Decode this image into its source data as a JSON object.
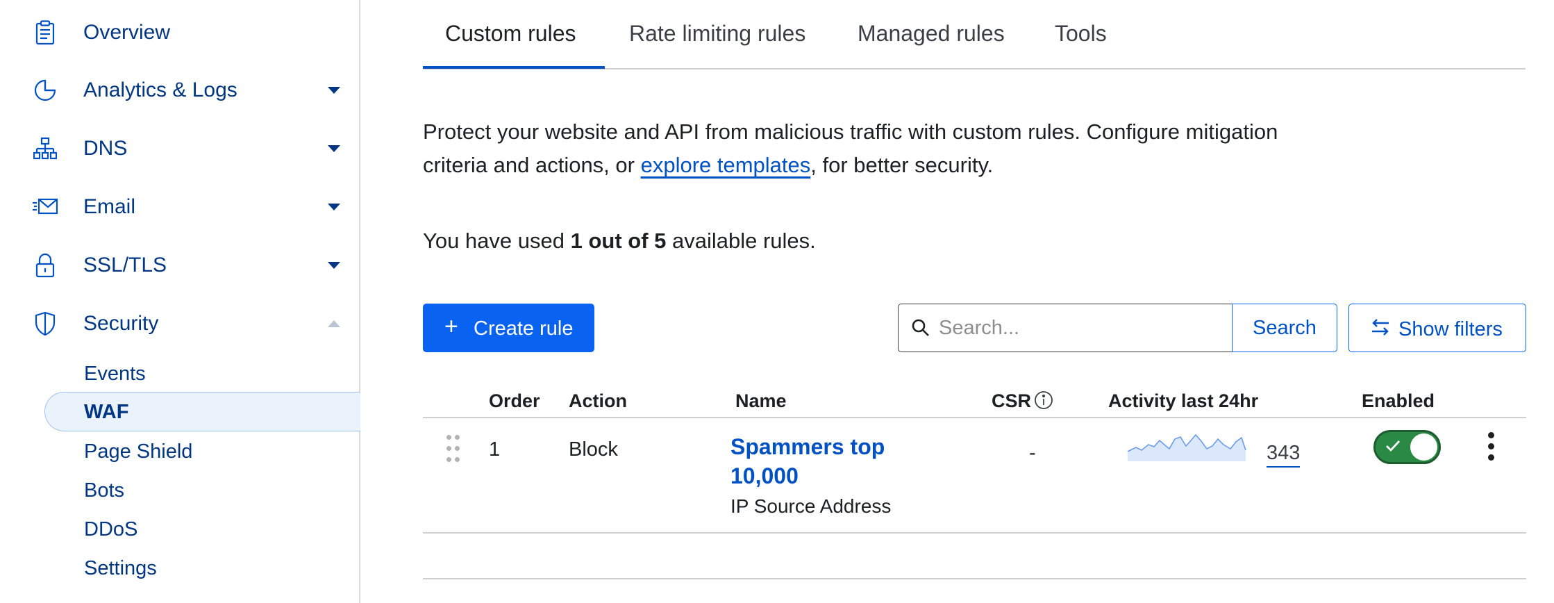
{
  "sidebar": {
    "items": [
      {
        "label": "Overview",
        "icon": "clipboard-icon"
      },
      {
        "label": "Analytics & Logs",
        "icon": "pie-chart-icon"
      },
      {
        "label": "DNS",
        "icon": "network-icon"
      },
      {
        "label": "Email",
        "icon": "email-icon"
      },
      {
        "label": "SSL/TLS",
        "icon": "lock-icon"
      },
      {
        "label": "Security",
        "icon": "shield-icon"
      }
    ],
    "security_sub": [
      "Events",
      "WAF",
      "Page Shield",
      "Bots",
      "DDoS",
      "Settings"
    ],
    "active_sub": "WAF"
  },
  "tabs": [
    "Custom rules",
    "Rate limiting rules",
    "Managed rules",
    "Tools"
  ],
  "intro": {
    "before": "Protect your website and API from malicious traffic with custom rules. Configure mitigation criteria and actions, or ",
    "link": "explore templates",
    "after": ", for better security."
  },
  "usage": {
    "before": "You have used ",
    "bold": "1 out of 5",
    "after": " available rules."
  },
  "toolbar": {
    "create_label": "Create rule",
    "search_placeholder": "Search...",
    "search_label": "Search",
    "filters_label": "Show filters"
  },
  "table": {
    "headers": {
      "order": "Order",
      "action": "Action",
      "name": "Name",
      "csr": "CSR",
      "activity": "Activity last 24hr",
      "enabled": "Enabled"
    },
    "rows": [
      {
        "order": "1",
        "action": "Block",
        "name": "Spammers top 10,000",
        "subtitle": "IP Source Address",
        "csr": "-",
        "activity_count": "343",
        "enabled": true
      }
    ]
  },
  "colors": {
    "accent": "#0051c3",
    "primary_button": "#0a62f0",
    "toggle_on": "#2a8a45",
    "nav_text": "#003682"
  }
}
